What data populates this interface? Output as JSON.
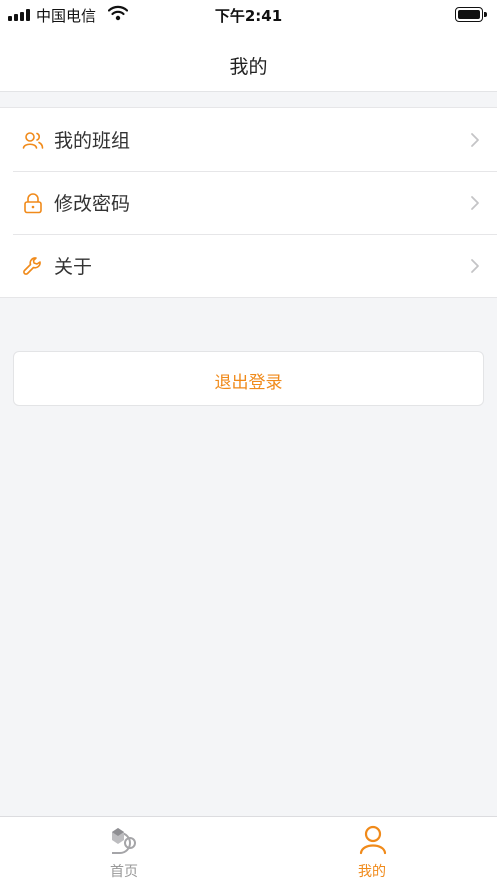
{
  "status_bar": {
    "carrier": "中国电信",
    "time": "下午2:41"
  },
  "header": {
    "title": "我的"
  },
  "menu": {
    "items": [
      {
        "label": "我的班组",
        "icon": "team-icon"
      },
      {
        "label": "修改密码",
        "icon": "lock-icon"
      },
      {
        "label": "关于",
        "icon": "wrench-icon"
      }
    ]
  },
  "logout": {
    "label": "退出登录"
  },
  "tab_bar": {
    "tabs": [
      {
        "label": "首页",
        "icon": "home-icon",
        "active": false
      },
      {
        "label": "我的",
        "icon": "person-icon",
        "active": true
      }
    ]
  },
  "colors": {
    "accent": "#f08a1a",
    "background": "#f4f5f7",
    "inactive": "#999999"
  }
}
